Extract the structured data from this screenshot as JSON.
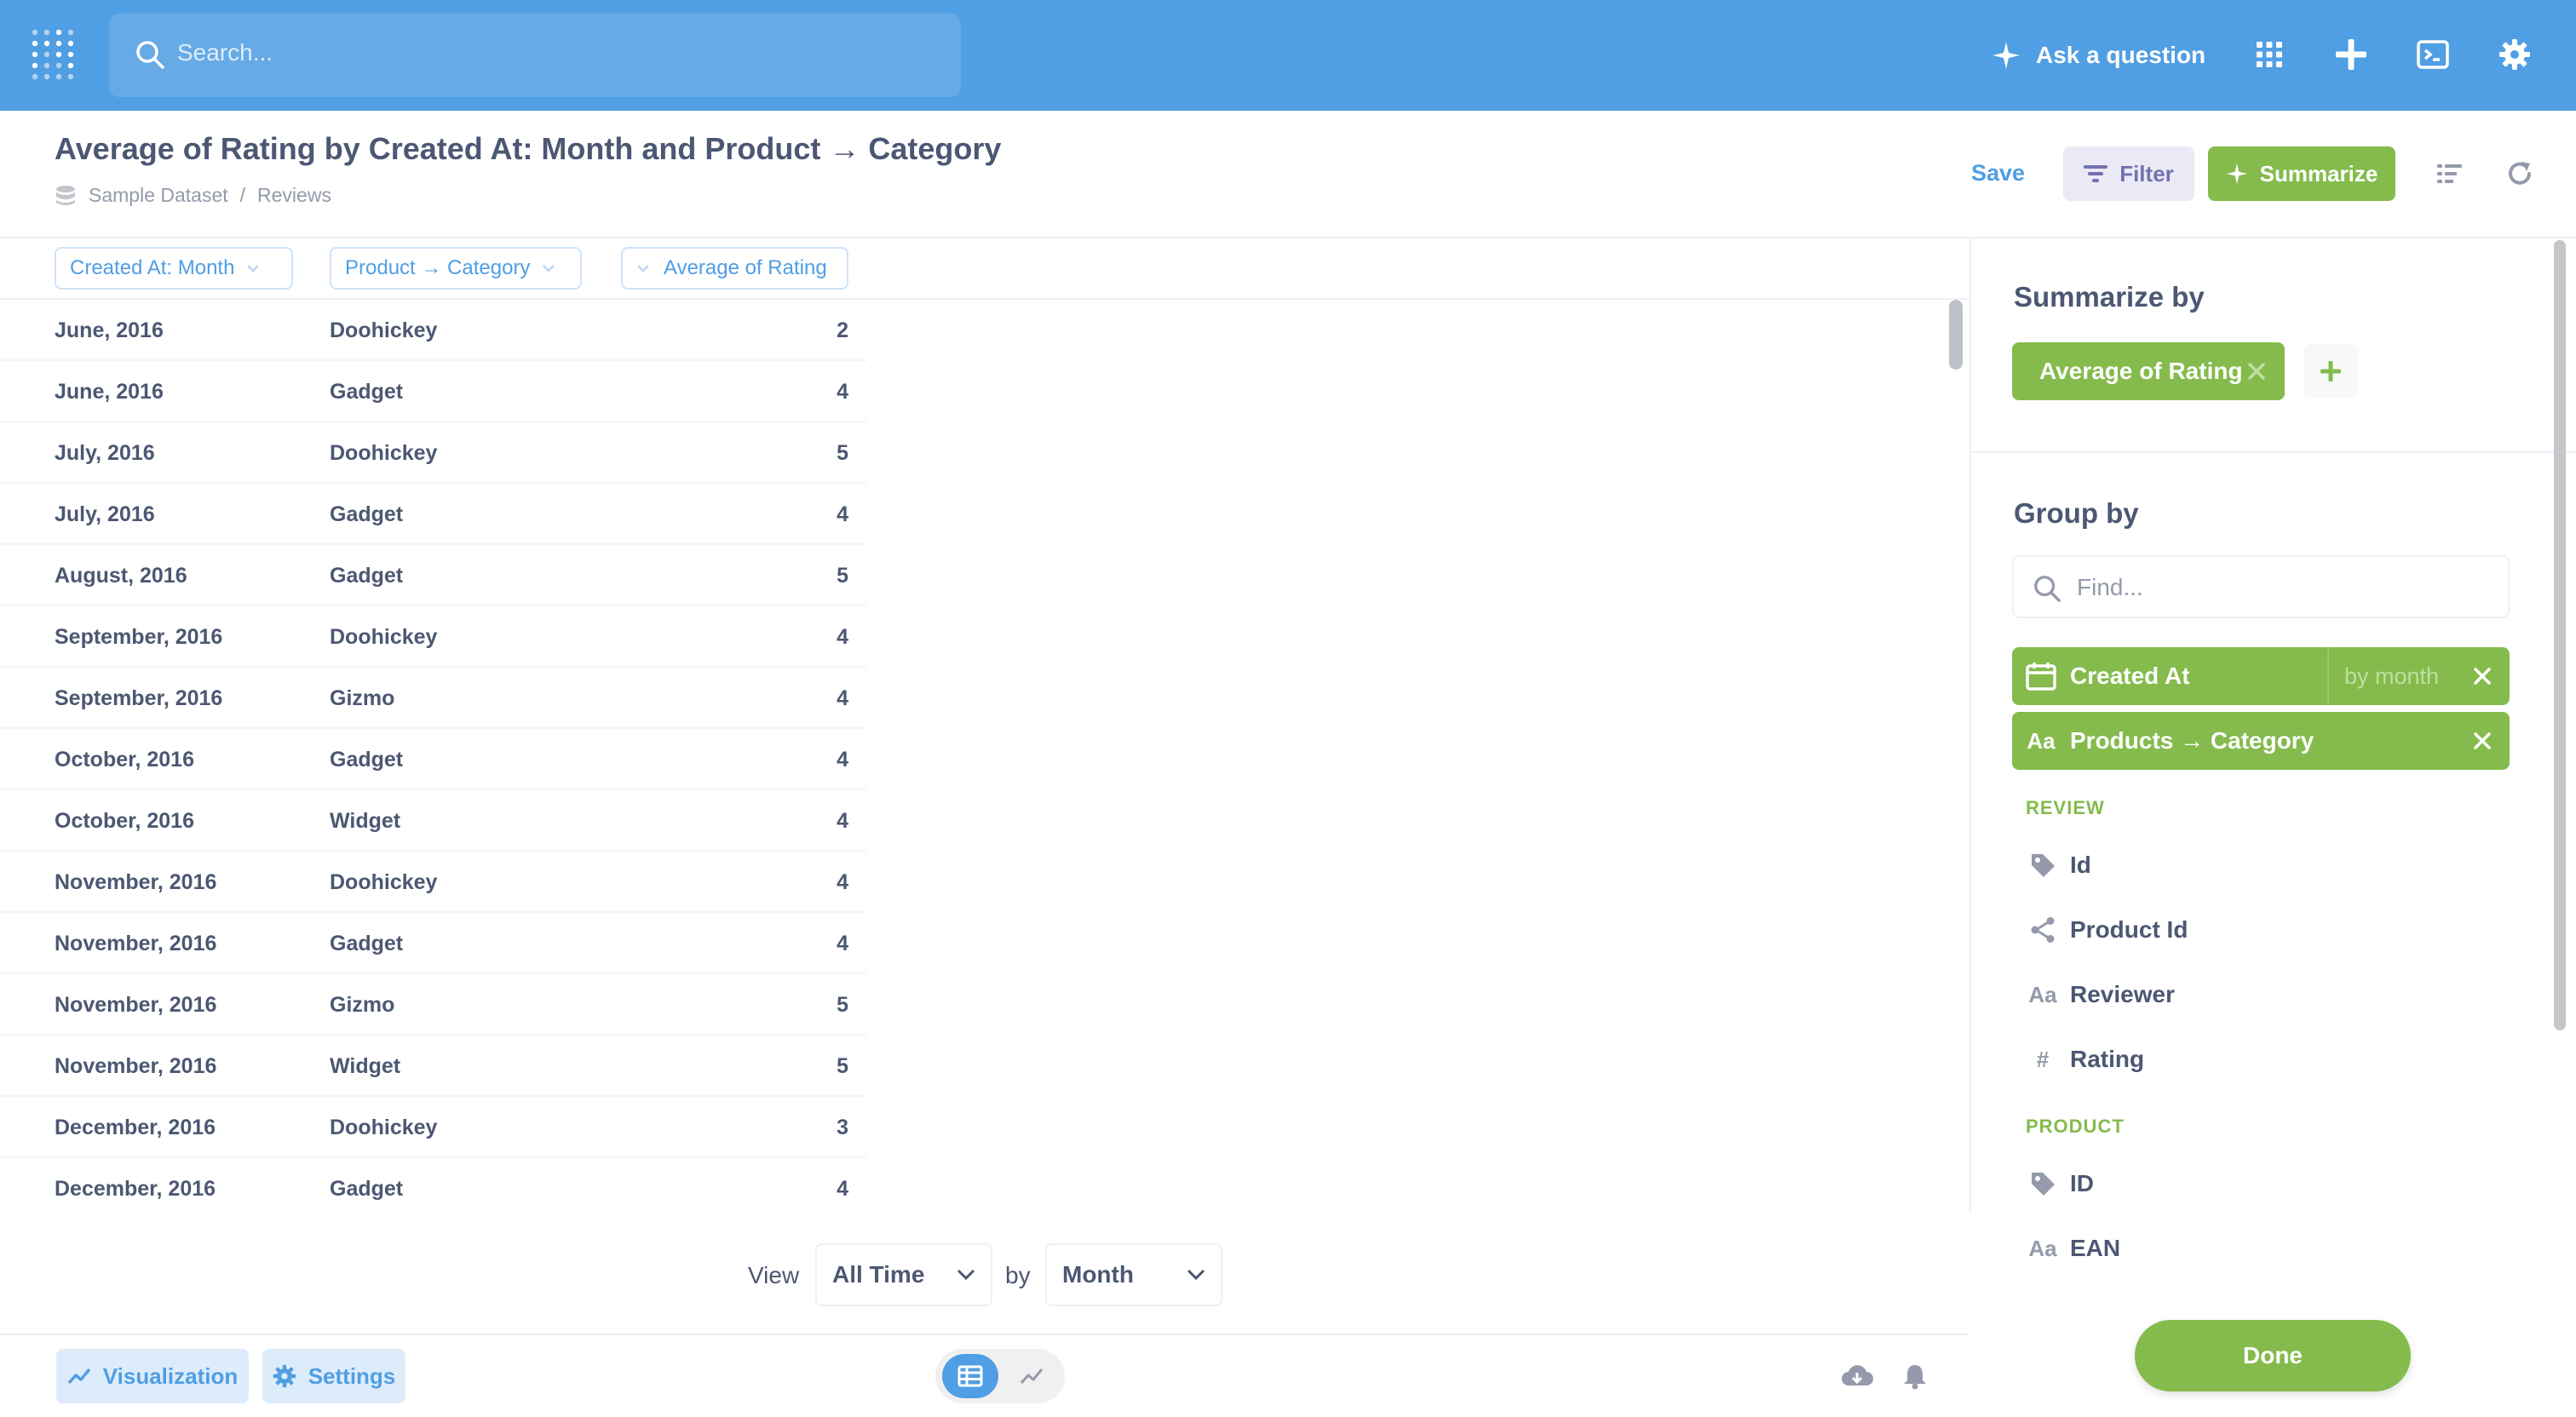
{
  "topbar": {
    "search_placeholder": "Search...",
    "ask_label": "Ask a question"
  },
  "question": {
    "title": "Average of Rating by Created At: Month and Product → Category",
    "breadcrumb": [
      "Sample Dataset",
      "Reviews"
    ],
    "save_label": "Save",
    "filter_label": "Filter",
    "summarize_label": "Summarize"
  },
  "table": {
    "columns": [
      "Created At: Month",
      "Product → Category",
      "Average of Rating"
    ],
    "rows": [
      [
        "June, 2016",
        "Doohickey",
        "2"
      ],
      [
        "June, 2016",
        "Gadget",
        "4"
      ],
      [
        "July, 2016",
        "Doohickey",
        "5"
      ],
      [
        "July, 2016",
        "Gadget",
        "4"
      ],
      [
        "August, 2016",
        "Gadget",
        "5"
      ],
      [
        "September, 2016",
        "Doohickey",
        "4"
      ],
      [
        "September, 2016",
        "Gizmo",
        "4"
      ],
      [
        "October, 2016",
        "Gadget",
        "4"
      ],
      [
        "October, 2016",
        "Widget",
        "4"
      ],
      [
        "November, 2016",
        "Doohickey",
        "4"
      ],
      [
        "November, 2016",
        "Gadget",
        "4"
      ],
      [
        "November, 2016",
        "Gizmo",
        "5"
      ],
      [
        "November, 2016",
        "Widget",
        "5"
      ],
      [
        "December, 2016",
        "Doohickey",
        "3"
      ],
      [
        "December, 2016",
        "Gadget",
        "4"
      ]
    ]
  },
  "view_controls": {
    "view_label": "View",
    "period_value": "All Time",
    "by_label": "by",
    "granularity_value": "Month"
  },
  "footer": {
    "visualization_label": "Visualization",
    "settings_label": "Settings"
  },
  "sidebar": {
    "summarize_heading": "Summarize by",
    "metric_label": "Average of Rating",
    "group_heading": "Group by",
    "find_placeholder": "Find...",
    "groupings": [
      {
        "icon": "calendar-icon",
        "label": "Created At",
        "bin": "by month"
      },
      {
        "icon": "text-icon",
        "icon_text": "Aa",
        "label": "Products → Category"
      }
    ],
    "sections": [
      {
        "title": "REVIEW",
        "fields": [
          {
            "icon": "tag-icon",
            "label": "Id"
          },
          {
            "icon": "connection-icon",
            "label": "Product Id"
          },
          {
            "icon": "text-icon",
            "icon_text": "Aa",
            "label": "Reviewer"
          },
          {
            "icon": "number-icon",
            "icon_text": "#",
            "label": "Rating"
          }
        ]
      },
      {
        "title": "PRODUCT",
        "fields": [
          {
            "icon": "tag-icon",
            "label": "ID"
          },
          {
            "icon": "text-icon",
            "icon_text": "Aa",
            "label": "EAN"
          }
        ]
      }
    ],
    "done_label": "Done"
  },
  "colors": {
    "brand": "#509ee3",
    "summarize": "#84bb4c",
    "filter": "#7172ad",
    "text": "#4c5773"
  }
}
